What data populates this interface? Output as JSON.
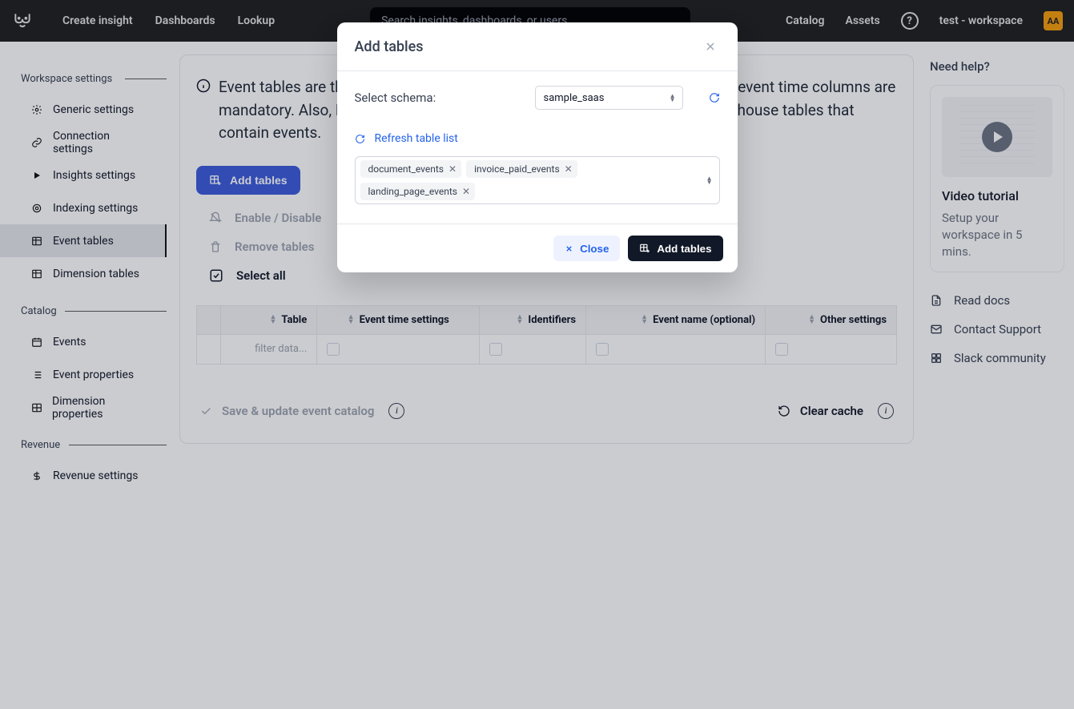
{
  "topbar": {
    "nav": {
      "create": "Create insight",
      "dashboards": "Dashboards",
      "lookup": "Lookup"
    },
    "search_placeholder": "Search insights, dashboards, or users",
    "right": {
      "catalog": "Catalog",
      "assets": "Assets",
      "help": "?",
      "workspace": "test - workspace",
      "avatar": "AA"
    }
  },
  "sidebar": {
    "section1": {
      "title": "Workspace settings",
      "items": [
        "Generic settings",
        "Connection settings",
        "Insights settings",
        "Indexing settings",
        "Event tables",
        "Dimension tables"
      ]
    },
    "section2": {
      "title": "Catalog",
      "items": [
        "Events",
        "Event properties",
        "Dimension properties"
      ]
    },
    "section3": {
      "title": "Revenue",
      "items": [
        "Revenue settings"
      ]
    },
    "active": "Event tables"
  },
  "main": {
    "info": "Event tables are the base for your Mitzu project. Please note that user ID and event time columns are mandatory. Also, Mitzu is not a dashboarding tool and reserved for data warehouse tables that contain events.",
    "buttons": {
      "add": "Add tables"
    },
    "actions": {
      "enable": "Enable / Disable",
      "remove": "Remove tables",
      "select_all": "Select all"
    },
    "table": {
      "cols": [
        "Table",
        "Event time settings",
        "Identifiers",
        "Event name (optional)",
        "Other settings"
      ],
      "filter_placeholder": "filter data..."
    },
    "bottom": {
      "save": "Save & update event catalog",
      "clear": "Clear cache"
    }
  },
  "rcol": {
    "heading": "Need help?",
    "video": {
      "title": "Video tutorial",
      "sub": "Setup your workspace in 5 mins."
    },
    "links": [
      "Read docs",
      "Contact Support",
      "Slack community"
    ]
  },
  "modal": {
    "title": "Add tables",
    "schema_label": "Select schema:",
    "schema_value": "sample_saas",
    "refresh": "Refresh table list",
    "chips": [
      "document_events",
      "invoice_paid_events",
      "landing_page_events"
    ],
    "close": "Close",
    "add": "Add tables"
  }
}
